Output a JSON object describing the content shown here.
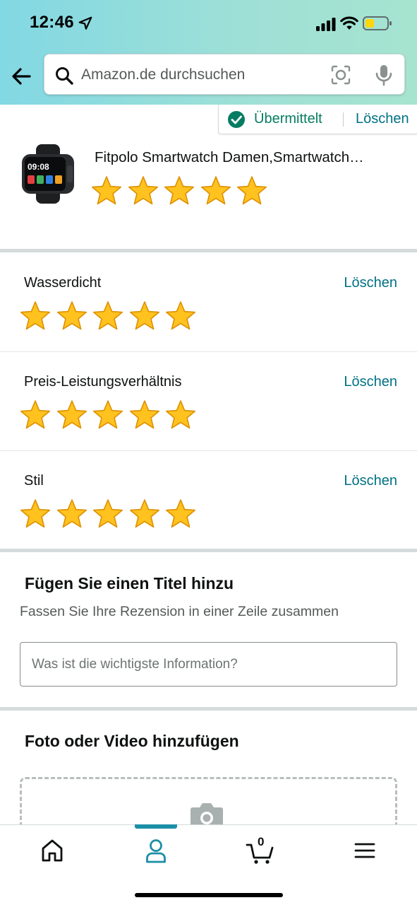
{
  "status_bar": {
    "time": "12:46"
  },
  "search": {
    "placeholder": "Amazon.de durchsuchen"
  },
  "submission": {
    "status": "Übermittelt",
    "delete_label": "Löschen"
  },
  "product": {
    "title": "Fitpolo Smartwatch Damen,Smartwatch…",
    "rating": 5,
    "max_rating": 5
  },
  "attributes": [
    {
      "label": "Wasserdicht",
      "delete_label": "Löschen",
      "rating": 5
    },
    {
      "label": "Preis-Leistungsverhältnis",
      "delete_label": "Löschen",
      "rating": 5
    },
    {
      "label": "Stil",
      "delete_label": "Löschen",
      "rating": 5
    }
  ],
  "title_section": {
    "heading": "Fügen Sie einen Titel hinzu",
    "subtitle": "Fassen Sie Ihre Rezension in einer Zeile zusammen",
    "input_value": "",
    "input_placeholder": "Was ist die wichtigste Information?"
  },
  "media_section": {
    "heading": "Foto oder Video hinzufügen"
  },
  "bottom_nav": {
    "items": [
      {
        "icon": "home-icon",
        "active": false
      },
      {
        "icon": "account-icon",
        "active": true
      },
      {
        "icon": "cart-icon",
        "active": false
      },
      {
        "icon": "menu-icon",
        "active": false
      }
    ],
    "cart_count": "0"
  },
  "colors": {
    "header_gradient_start": "#82d8e3",
    "header_gradient_end": "#a6e4d0",
    "link": "#007185",
    "success": "#067d62",
    "star_fill": "#ffc21e",
    "star_stroke": "#de9000",
    "active_nav": "#1b8fa6"
  }
}
